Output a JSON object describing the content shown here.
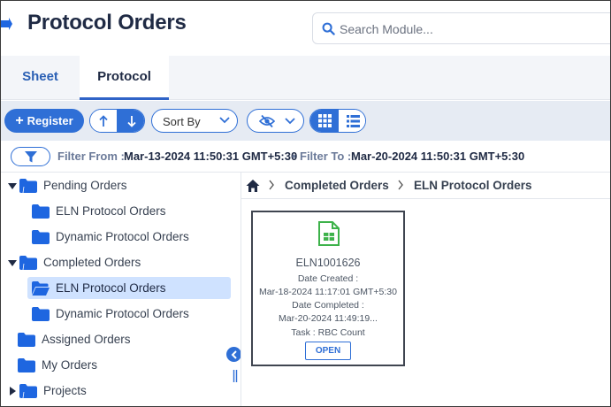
{
  "header": {
    "title": "Protocol Orders",
    "search_placeholder": "Search Module..."
  },
  "tabs": [
    {
      "label": "Sheet",
      "active": false
    },
    {
      "label": "Protocol",
      "active": true
    }
  ],
  "toolbar": {
    "register_label": "Register",
    "sort_by_label": "Sort By"
  },
  "filter": {
    "from_label": "Filter From :",
    "from_value": "Mar-13-2024 11:50:31 GMT+5:30",
    "bullet": "•",
    "to_label": "Filter To :",
    "to_value": "Mar-20-2024 11:50:31 GMT+5:30"
  },
  "tree": {
    "items": [
      {
        "label": "Pending Orders",
        "level": 0,
        "expanded": true
      },
      {
        "label": "ELN Protocol Orders",
        "level": 1
      },
      {
        "label": "Dynamic Protocol Orders",
        "level": 1
      },
      {
        "label": "Completed Orders",
        "level": 0,
        "expanded": true
      },
      {
        "label": "ELN Protocol Orders",
        "level": 1,
        "selected": true
      },
      {
        "label": "Dynamic Protocol Orders",
        "level": 1
      },
      {
        "label": "Assigned Orders",
        "level": 0
      },
      {
        "label": "My Orders",
        "level": 0
      },
      {
        "label": "Projects",
        "level": 0,
        "expanded": false
      }
    ]
  },
  "breadcrumb": [
    "Completed Orders",
    "ELN Protocol Orders"
  ],
  "card": {
    "name": "ELN1001626",
    "created_label": "Date Created :",
    "created_value": "Mar-18-2024 11:17:01 GMT+5:30",
    "completed_label": "Date Completed :",
    "completed_value": "Mar-20-2024 11:49:19...",
    "task": "Task : RBC Count",
    "open_label": "OPEN"
  },
  "colors": {
    "accent": "#2f6fd6",
    "title": "#1f2a44",
    "folder": "#1e66e0",
    "doc_icon": "#3db24a",
    "selected_bg": "#cfe2ff"
  }
}
